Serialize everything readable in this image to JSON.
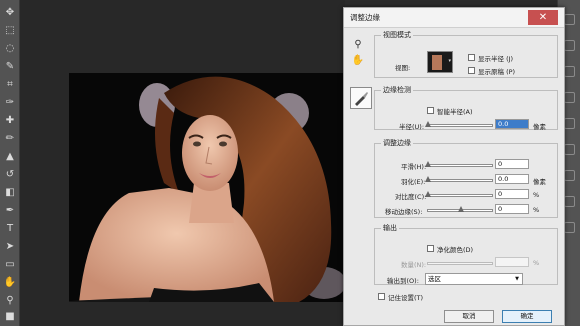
{
  "dialog": {
    "title": "调整边缘",
    "close_glyph": "✕",
    "view_mode": {
      "legend": "视图模式",
      "view_label": "视图:",
      "show_radius": "显示半径 (J)",
      "show_original": "显示原稿 (P)"
    },
    "edge_detection": {
      "legend": "边缘检测",
      "smart_radius": "智能半径(A)",
      "radius_label": "半径(U):",
      "radius_value": "0.0",
      "radius_unit": "像素"
    },
    "adjust_edge": {
      "legend": "调整边缘",
      "smooth_label": "平滑(H):",
      "smooth_value": "0",
      "feather_label": "羽化(E):",
      "feather_value": "0.0",
      "feather_unit": "像素",
      "contrast_label": "对比度(C):",
      "contrast_value": "0",
      "contrast_unit": "%",
      "shift_label": "移动边缘(S):",
      "shift_value": "0",
      "shift_unit": "%"
    },
    "output": {
      "legend": "输出",
      "decontaminate": "净化颜色(D)",
      "amount_label": "数量(N):",
      "amount_unit": "%",
      "output_to_label": "输出到(O):",
      "output_to_value": "选区",
      "dropdown_glyph": "▼"
    },
    "remember": "记住设置(T)",
    "cancel": "取消",
    "ok": "确定"
  },
  "colors": {
    "accent": "#3c7fb1",
    "close": "#c75050"
  }
}
